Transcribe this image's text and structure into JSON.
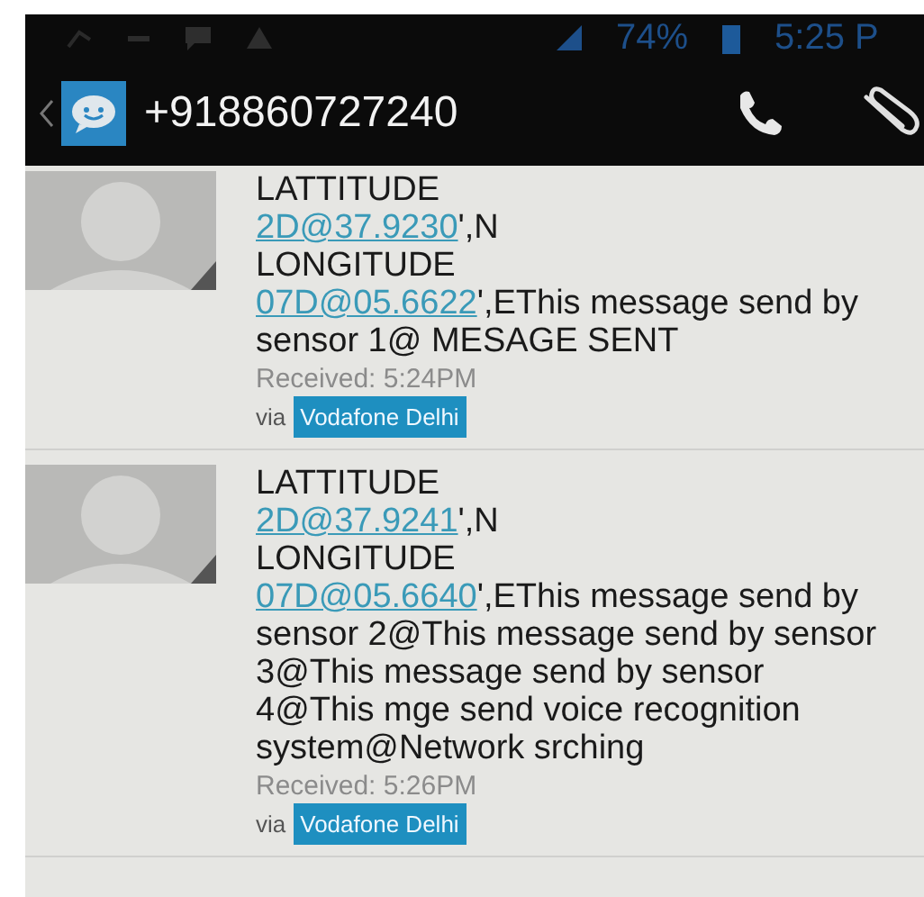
{
  "status_bar": {
    "battery": "74%",
    "time": "5:25 P"
  },
  "header": {
    "contact": "+918860727240"
  },
  "messages": [
    {
      "lines": [
        {
          "kind": "plain",
          "text": "LATTITUDE"
        },
        {
          "kind": "coord",
          "link": "2D@37.9230",
          "rest": "',N"
        },
        {
          "kind": "plain",
          "text": "LONGITUDE"
        },
        {
          "kind": "coord",
          "link": "07D@05.6622",
          "rest": "',EThis message send by sensor 1@   MESAGE SENT"
        }
      ],
      "received": "Received: 5:24PM",
      "via": "via",
      "carrier": "Vodafone Delhi"
    },
    {
      "lines": [
        {
          "kind": "plain",
          "text": "LATTITUDE"
        },
        {
          "kind": "coord",
          "link": "2D@37.9241",
          "rest": "',N"
        },
        {
          "kind": "plain",
          "text": "LONGITUDE"
        },
        {
          "kind": "coord",
          "link": "07D@05.6640",
          "rest": "',EThis message send by sensor 2@This message send by sensor 3@This message send by sensor 4@This mge send voice recognition system@Network srching"
        }
      ],
      "received": "Received: 5:26PM",
      "via": "via",
      "carrier": "Vodafone Delhi"
    }
  ]
}
